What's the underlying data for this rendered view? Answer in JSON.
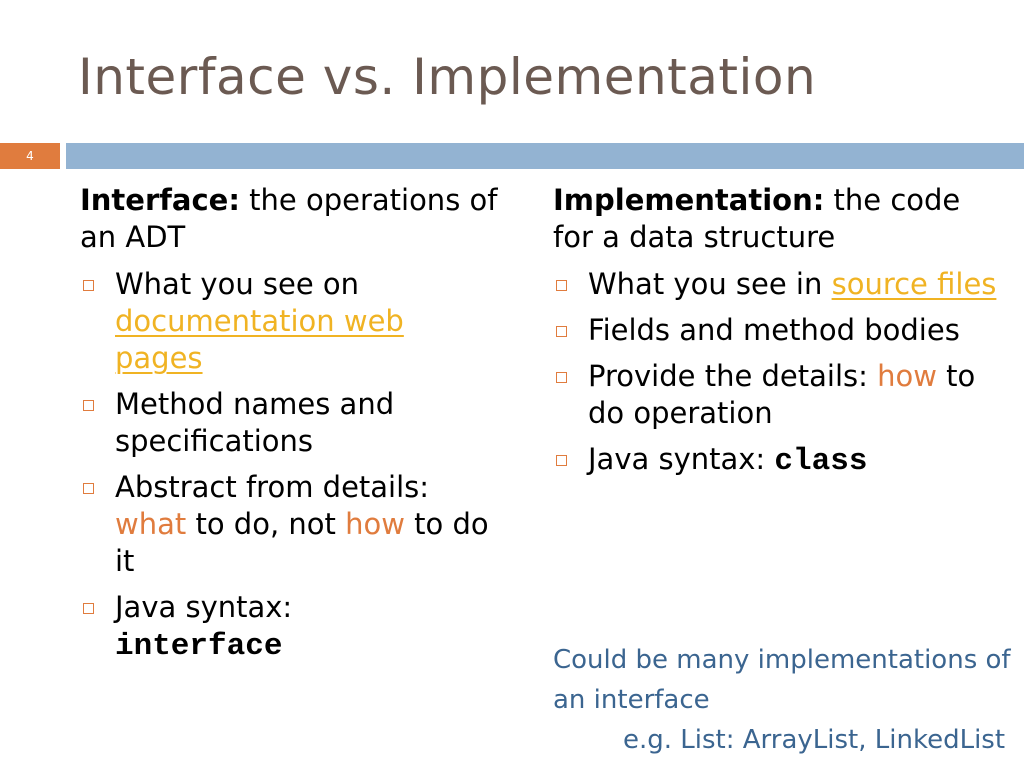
{
  "title": "Interface vs. Implementation",
  "slide_number": "4",
  "colors": {
    "accent_orange": "#e07c3e",
    "bar_blue": "#93b3d2",
    "link_gold": "#f0b323",
    "note_blue": "#3b6590",
    "title_brown": "#6b5a52"
  },
  "left": {
    "lead_bold": "Interface:",
    "lead_text": " the operations of an ADT",
    "bullets": [
      {
        "text": "What you see on ",
        "link": "documentation web pages"
      },
      {
        "text": "Method names and specifications"
      },
      {
        "pre": "Abstract from details: ",
        "what": "what",
        "mid": " to do, not ",
        "how": "how",
        "post": " to do it"
      },
      {
        "text": "Java syntax: ",
        "code": "interface"
      }
    ]
  },
  "right": {
    "lead_bold": "Implementation:",
    "lead_text": " the code for a data structure",
    "bullets": [
      {
        "text": "What you see in ",
        "link": "source files"
      },
      {
        "text": "Fields and method bodies"
      },
      {
        "text": "Provide the details: ",
        "how": "how",
        "post": " to do operation"
      },
      {
        "text": "Java syntax: ",
        "code": "class"
      }
    ]
  },
  "note": {
    "line1": "Could be many implementations of an interface",
    "example": "e.g. List:  ArrayList, LinkedList"
  }
}
